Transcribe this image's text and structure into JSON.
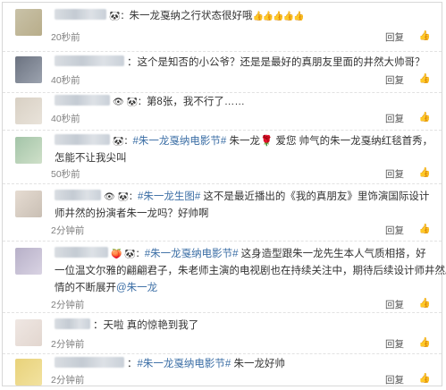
{
  "comments": [
    {
      "prefix": "🐼：",
      "text": "朱一龙戛纳之行状态很好哦",
      "suffix": "👍👍👍👍👍",
      "time": "20秒前",
      "reply": "回复",
      "like": "👍"
    },
    {
      "prefix": "：",
      "text": "这个是知否的小公爷？还是是最好的真朋友里面的井然大帅哥？",
      "time": "40秒前",
      "reply": "回复",
      "like": "👍"
    },
    {
      "prefix": "👁 🐼：",
      "text": "第8张，我不行了……",
      "time": "40秒前",
      "reply": "回复",
      "like": "👍"
    },
    {
      "prefix": "🐼：",
      "hashtag": "#朱一龙戛纳电影节#",
      "text_a": " 朱一龙🌹 爱您  帅气的朱一龙戛纳红毯首秀，",
      "text_b": "怎能不让我尖叫",
      "time": "50秒前",
      "reply": "回复",
      "like": "👍"
    },
    {
      "prefix": "👁 🐼：",
      "hashtag": "#朱一龙生图#",
      "text_a": " 这不是最近播出的《我的真朋友》里饰演国际设计",
      "text_b": "师井然的扮演者朱一龙吗？好帅啊",
      "time": "2分钟前",
      "reply": "回复",
      "like": "👍"
    },
    {
      "prefix": "🍑 🐼：",
      "hashtag": "#朱一龙戛纳电影节#",
      "text_a": " 这身造型跟朱一龙先生本人气质相搭，好",
      "text_b": "一位温文尔雅的翩翩君子，朱老师主演的电视剧也在持续关注中，期待后续设计师井然剧",
      "text_c": "情的不断展开",
      "mention": "@朱一龙",
      "time": "2分钟前",
      "reply": "回复",
      "like": "👍"
    },
    {
      "prefix": "：",
      "text": "天啦 真的惊艳到我了",
      "time": "2分钟前",
      "reply": "回复",
      "like": "👍"
    },
    {
      "prefix": "：",
      "hashtag": "#朱一龙戛纳电影节#",
      "text": " 朱一龙好帅",
      "time": "2分钟前",
      "reply": "回复",
      "like": "👍"
    }
  ],
  "colors": {
    "link": "#3b6ea5",
    "time": "#808080",
    "text": "#333333"
  }
}
